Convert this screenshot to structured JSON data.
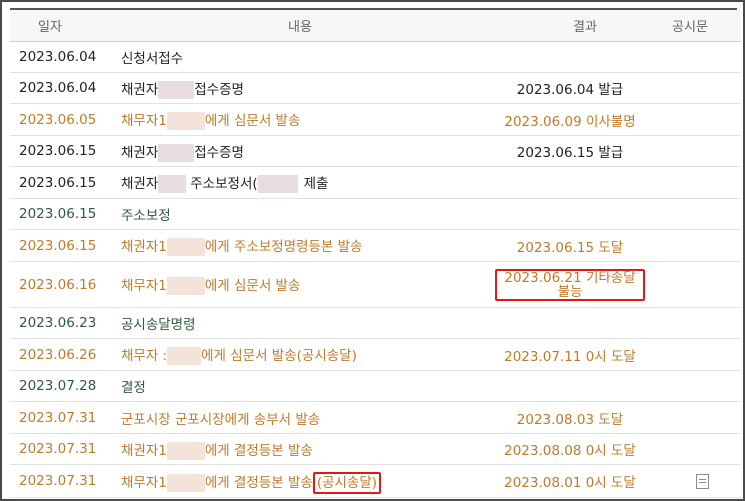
{
  "headers": {
    "date": "일자",
    "content": "내용",
    "result": "결과",
    "notice": "공시문"
  },
  "rows": [
    {
      "date": "2023.06.04",
      "pre": "신청서접수",
      "post": "",
      "result": "",
      "color": "black"
    },
    {
      "date": "2023.06.04",
      "pre": "채권자",
      "post": "접수증명",
      "result": "2023.06.04 발급",
      "color": "black"
    },
    {
      "date": "2023.06.05",
      "pre": "채무자1",
      "post": "에게 심문서 발송",
      "result": "2023.06.09 이사불명",
      "color": "orange"
    },
    {
      "date": "2023.06.15",
      "pre": "채권자",
      "post": "접수증명",
      "result": "2023.06.15 발급",
      "color": "black"
    },
    {
      "date": "2023.06.15",
      "pre": "채권자",
      "post": "주소보정서(",
      "post2": "제출",
      "result": "",
      "color": "black"
    },
    {
      "date": "2023.06.15",
      "pre": "주소보정",
      "post": "",
      "result": "",
      "color": "green"
    },
    {
      "date": "2023.06.15",
      "pre": "채권자1",
      "post": "에게 주소보정명령등본 발송",
      "result": "2023.06.15 도달",
      "color": "orange"
    },
    {
      "date": "2023.06.16",
      "pre": "채무자1",
      "post": "에게 심문서 발송",
      "result_line1": "2023.06.21 기타송달",
      "result_line2": "불능",
      "color": "orange"
    },
    {
      "date": "2023.06.23",
      "pre": "공시송달명령",
      "post": "",
      "result": "",
      "color": "green"
    },
    {
      "date": "2023.06.26",
      "pre": "채무자 :",
      "post": "에게 심문서 발송(공시송달)",
      "result": "2023.07.11 0시 도달",
      "color": "orange"
    },
    {
      "date": "2023.07.28",
      "pre": "결정",
      "post": "",
      "result": "",
      "color": "green"
    },
    {
      "date": "2023.07.31",
      "pre": "군포시장 군포시장에게 송부서 발송",
      "post": "",
      "result": "2023.08.03 도달",
      "color": "orange"
    },
    {
      "date": "2023.07.31",
      "pre": "채권자1",
      "post": "에게 결정등본 발송",
      "result": "2023.08.08 0시 도달",
      "color": "orange"
    },
    {
      "date": "2023.07.31",
      "pre": "채무자1",
      "post": "에게 결정등본 발송",
      "post_boxed": "(공시송달)",
      "result": "2023.08.01 0시 도달",
      "notice_icon": "document-icon",
      "color": "orange"
    }
  ],
  "colors": {
    "black": "#222222",
    "orange": "#c07a2a",
    "green": "#2f5a3c",
    "highlight": "#e01818"
  }
}
